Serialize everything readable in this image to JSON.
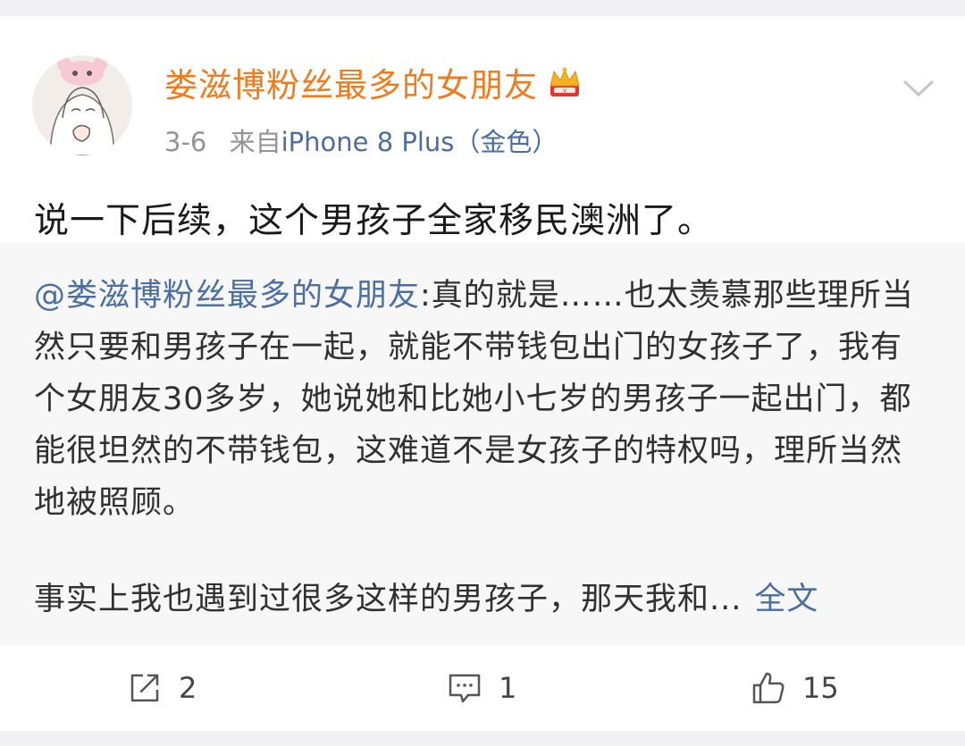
{
  "post": {
    "user_name": "娄滋博粉丝最多的女朋友",
    "date": "3-6",
    "source_prefix": "来自",
    "source": "iPhone 8 Plus（金色）",
    "text": "说一下后续，这个男孩子全家移民澳洲了。"
  },
  "retweet": {
    "mention": "@娄滋博粉丝最多的女朋友",
    "body": ":真的就是……也太羡慕那些理所当然只要和男孩子在一起，就能不带钱包出门的女孩子了，我有个女朋友30多岁，她说她和比她小七岁的男孩子一起出门，都能很坦然的不带钱包，这难道不是女孩子的特权吗，理所当然地被照顾。",
    "continuation": "事实上我也遇到过很多这样的男孩子，那天我和...",
    "full_text_link": "全文"
  },
  "actions": {
    "repost_count": "2",
    "comment_count": "1",
    "like_count": "15"
  },
  "icons": {
    "crown": "crown-icon",
    "chevron": "chevron-down-icon",
    "repost": "share-icon",
    "comment": "comment-icon",
    "like": "thumbs-up-icon"
  },
  "colors": {
    "user_name": "#f07b1f",
    "link": "#4a6fa0",
    "meta": "#939393"
  }
}
